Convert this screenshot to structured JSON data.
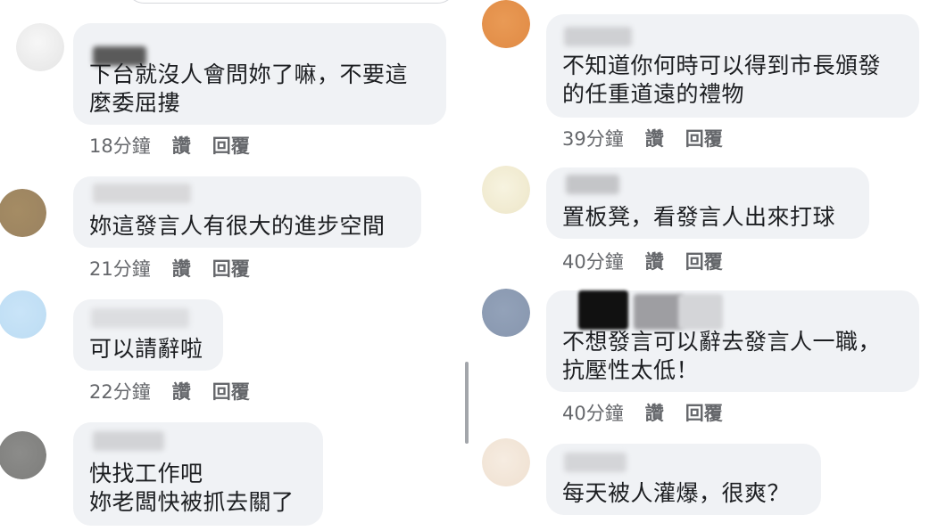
{
  "colors": {
    "bubble": "#f0f2f5",
    "text": "#1c1e21",
    "meta": "#65676b",
    "scrollbar": "#a3a6ab"
  },
  "left_comments": [
    {
      "text": "下台就沒人會問妳了嘛，不要這\n麼委屈摟",
      "time": "18分鐘",
      "like": "讚",
      "reply": "回覆",
      "avatar_color": "#efefef"
    },
    {
      "text": "妳這發言人有很大的進步空間",
      "time": "21分鐘",
      "like": "讚",
      "reply": "回覆",
      "avatar_color": "#a08a66"
    },
    {
      "text": "可以請辭啦",
      "time": "22分鐘",
      "like": "讚",
      "reply": "回覆",
      "avatar_color": "#c6e2f7"
    },
    {
      "text": "快找工作吧\n妳老闆快被抓去關了",
      "time": "",
      "like": "",
      "reply": "",
      "avatar_color": "#8a8a88"
    }
  ],
  "right_comments": [
    {
      "text": "不知道你何時可以得到市長頒發\n的任重道遠的禮物",
      "time": "39分鐘",
      "like": "讚",
      "reply": "回覆",
      "avatar_color": "#e8954f"
    },
    {
      "text": "置板凳，看發言人出來打球",
      "time": "40分鐘",
      "like": "讚",
      "reply": "回覆",
      "avatar_color": "#f3eed8"
    },
    {
      "text": "不想發言可以辭去發言人一職，\n抗壓性太低！",
      "time": "40分鐘",
      "like": "讚",
      "reply": "回覆",
      "avatar_color": "#8e9db5"
    },
    {
      "text": "每天被人灌爆，很爽？",
      "time": "",
      "like": "",
      "reply": "",
      "avatar_color": "#f4e8dc"
    }
  ]
}
